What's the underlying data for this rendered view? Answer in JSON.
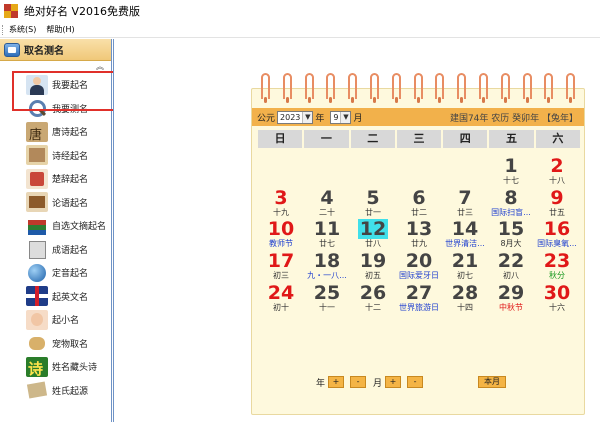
{
  "window": {
    "title": "绝对好名 V2016免费版"
  },
  "menu": {
    "items": [
      "系统(S)",
      "帮助(H)"
    ]
  },
  "sidebar": {
    "header": "取名测名",
    "items": [
      {
        "label": "我要起名",
        "icon": "person-icon",
        "css": "ic-person"
      },
      {
        "label": "我要测名",
        "icon": "magnifier-icon",
        "css": "ic-magnifier"
      },
      {
        "label": "唐诗起名",
        "icon": "tang-poem-icon",
        "css": "ic-tang"
      },
      {
        "label": "诗经起名",
        "icon": "book-of-songs-icon",
        "css": "ic-scroll"
      },
      {
        "label": "楚辞起名",
        "icon": "chuci-icon",
        "css": "ic-red"
      },
      {
        "label": "论语起名",
        "icon": "analects-icon",
        "css": "ic-book"
      },
      {
        "label": "自选文摘起名",
        "icon": "books-icon",
        "css": "ic-books"
      },
      {
        "label": "成语起名",
        "icon": "idiom-icon",
        "css": "ic-chinese"
      },
      {
        "label": "定音起名",
        "icon": "globe-icon",
        "css": "ic-globe"
      },
      {
        "label": "起英文名",
        "icon": "uk-flag-icon",
        "css": "ic-uk"
      },
      {
        "label": "起小名",
        "icon": "baby-icon",
        "css": "ic-baby"
      },
      {
        "label": "宠物取名",
        "icon": "dog-icon",
        "css": "ic-dog"
      },
      {
        "label": "姓名藏头诗",
        "icon": "poem-icon",
        "css": "ic-poem"
      },
      {
        "label": "姓氏起源",
        "icon": "scroll-icon",
        "css": "ic-history"
      }
    ]
  },
  "calendar": {
    "era_label": "公元",
    "year": "2023",
    "year_unit": "年",
    "month": "9",
    "month_unit": "月",
    "lunar_info": "建国74年 农历 癸卯年 【兔年】",
    "weekdays": [
      "日",
      "一",
      "二",
      "三",
      "四",
      "五",
      "六"
    ],
    "days": [
      {
        "n": "",
        "l": "",
        "c": ""
      },
      {
        "n": "",
        "l": "",
        "c": ""
      },
      {
        "n": "",
        "l": "",
        "c": ""
      },
      {
        "n": "",
        "l": "",
        "c": ""
      },
      {
        "n": "",
        "l": "",
        "c": ""
      },
      {
        "n": "1",
        "l": "十七",
        "c": ""
      },
      {
        "n": "2",
        "l": "十八",
        "c": "",
        "red": true
      },
      {
        "n": "3",
        "l": "十九",
        "c": "",
        "red": true
      },
      {
        "n": "4",
        "l": "二十",
        "c": ""
      },
      {
        "n": "5",
        "l": "廿一",
        "c": ""
      },
      {
        "n": "6",
        "l": "廿二",
        "c": ""
      },
      {
        "n": "7",
        "l": "廿三",
        "c": ""
      },
      {
        "n": "8",
        "l": "国际扫盲...",
        "c": "blue"
      },
      {
        "n": "9",
        "l": "廿五",
        "c": "",
        "red": true
      },
      {
        "n": "10",
        "l": "教师节",
        "c": "blue",
        "red": true
      },
      {
        "n": "11",
        "l": "廿七",
        "c": ""
      },
      {
        "n": "12",
        "l": "廿八",
        "c": "",
        "today": true
      },
      {
        "n": "13",
        "l": "廿九",
        "c": ""
      },
      {
        "n": "14",
        "l": "世界清洁...",
        "c": "blue"
      },
      {
        "n": "15",
        "l": "8月大",
        "c": ""
      },
      {
        "n": "16",
        "l": "国际臭氧...",
        "c": "blue",
        "red": true
      },
      {
        "n": "17",
        "l": "初三",
        "c": "",
        "red": true
      },
      {
        "n": "18",
        "l": "九・一八...",
        "c": "blue"
      },
      {
        "n": "19",
        "l": "初五",
        "c": ""
      },
      {
        "n": "20",
        "l": "国际爱牙日",
        "c": "blue"
      },
      {
        "n": "21",
        "l": "初七",
        "c": ""
      },
      {
        "n": "22",
        "l": "初八",
        "c": ""
      },
      {
        "n": "23",
        "l": "秋分",
        "c": "green",
        "red": true
      },
      {
        "n": "24",
        "l": "初十",
        "c": "",
        "red": true
      },
      {
        "n": "25",
        "l": "十一",
        "c": ""
      },
      {
        "n": "26",
        "l": "十二",
        "c": ""
      },
      {
        "n": "27",
        "l": "世界旅游日",
        "c": "blue"
      },
      {
        "n": "28",
        "l": "十四",
        "c": ""
      },
      {
        "n": "29",
        "l": "中秋节",
        "c": "redl"
      },
      {
        "n": "30",
        "l": "十六",
        "c": "",
        "red": true
      }
    ],
    "footer": {
      "year_label": "年",
      "month_label": "月",
      "plus": "+",
      "minus": "-",
      "this_month": "本月"
    }
  }
}
